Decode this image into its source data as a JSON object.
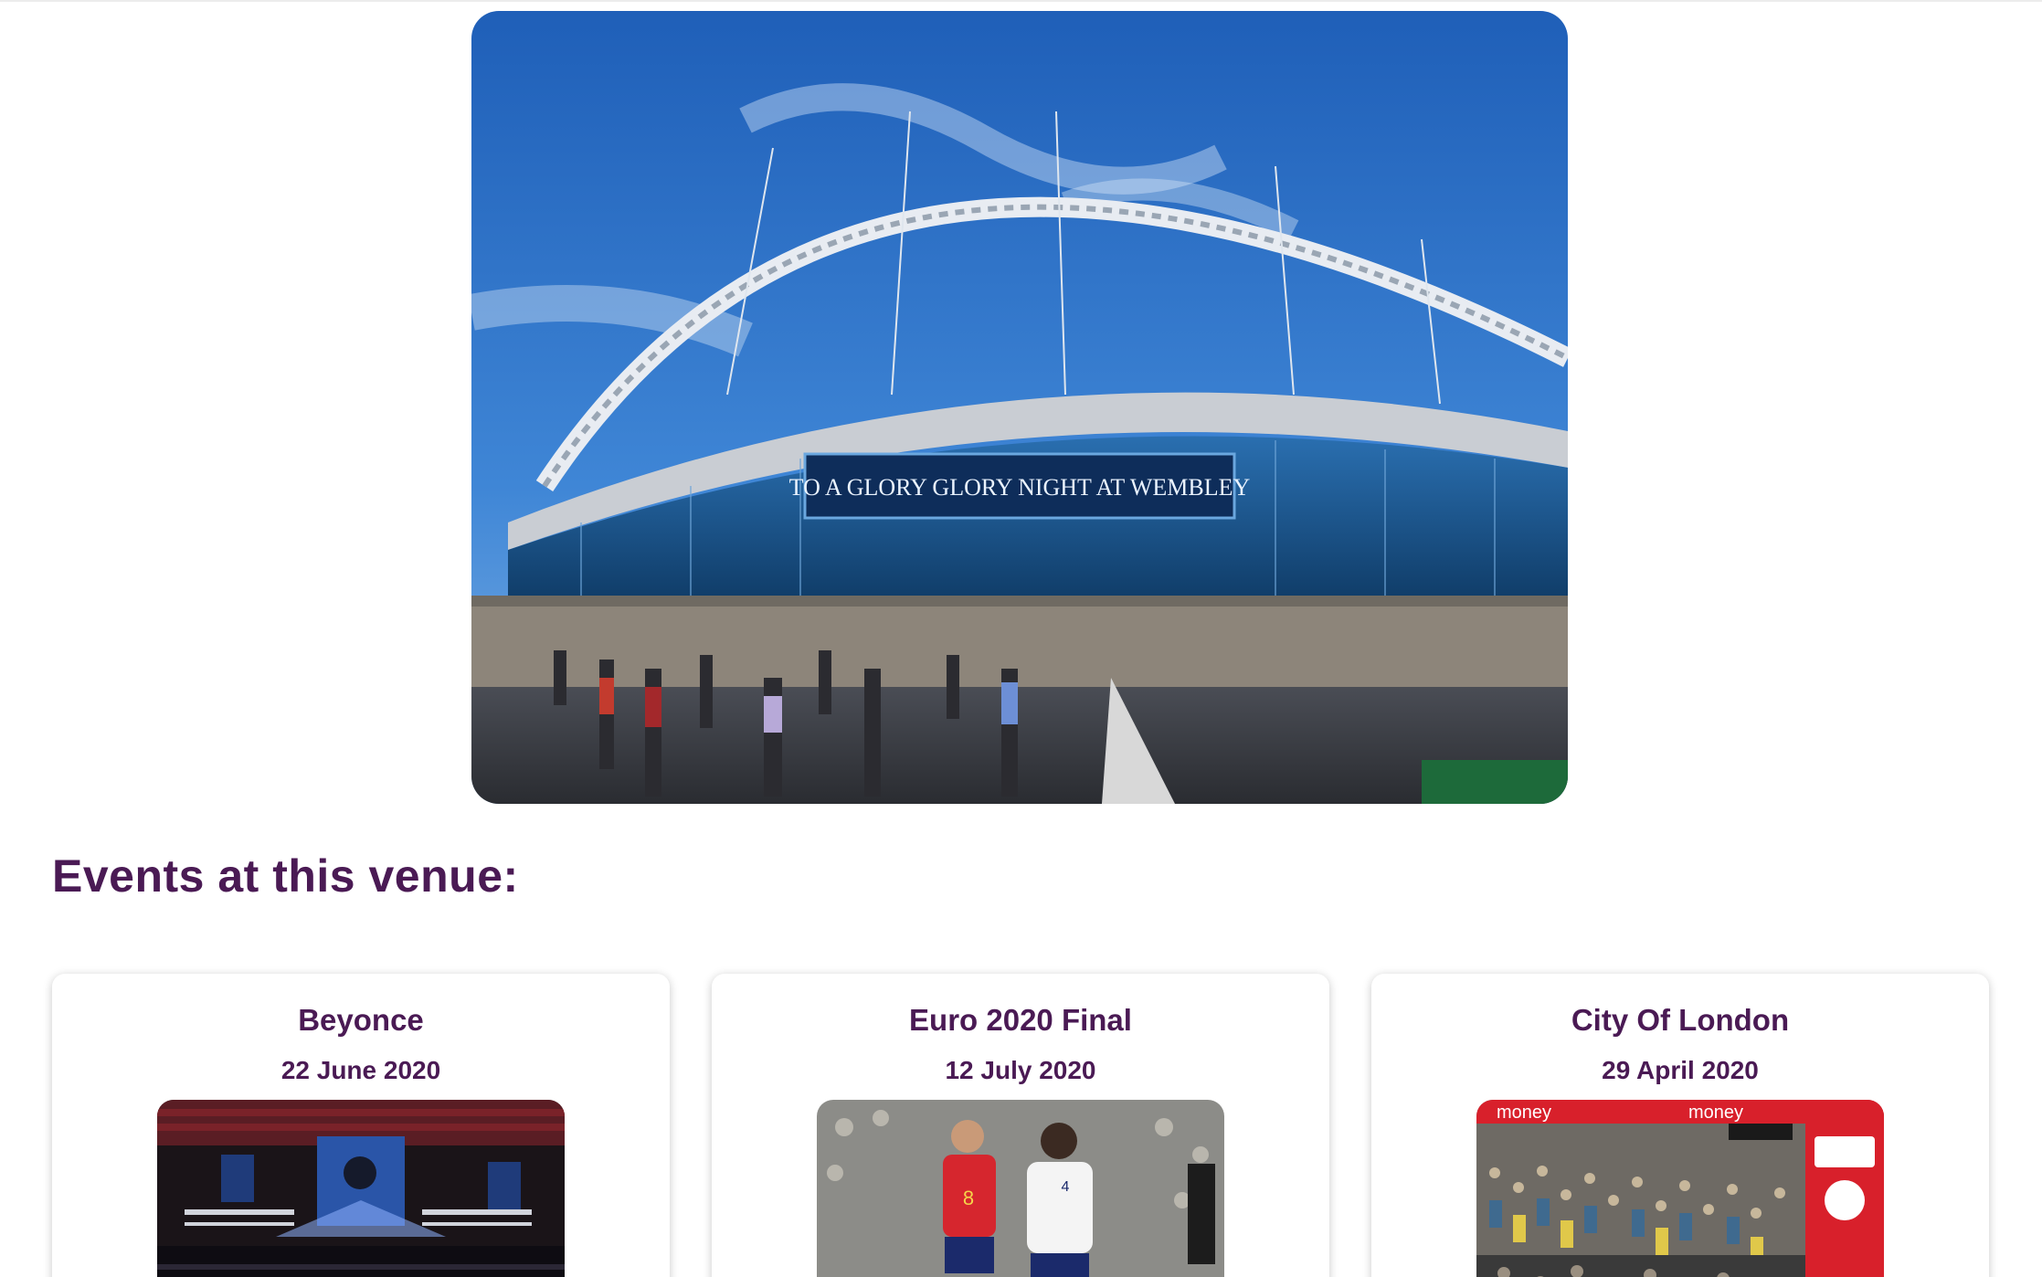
{
  "hero": {
    "image_icon": "stadium-photo",
    "banner_text": "TO A GLORY GLORY NIGHT AT WEMBLEY"
  },
  "section": {
    "title": "Events at this venue:"
  },
  "events": [
    {
      "name": "Beyonce",
      "date": "22 June 2020",
      "image_icon": "concert-photo"
    },
    {
      "name": "Euro 2020 Final",
      "date": "12 July 2020",
      "image_icon": "football-photo"
    },
    {
      "name": "City Of London",
      "date": "29 April 2020",
      "image_icon": "marathon-photo",
      "sign_text": "money"
    }
  ],
  "colors": {
    "heading": "#4a1a54",
    "sky": "#2f6fc4",
    "card_shadow": "#cfcfcf"
  }
}
